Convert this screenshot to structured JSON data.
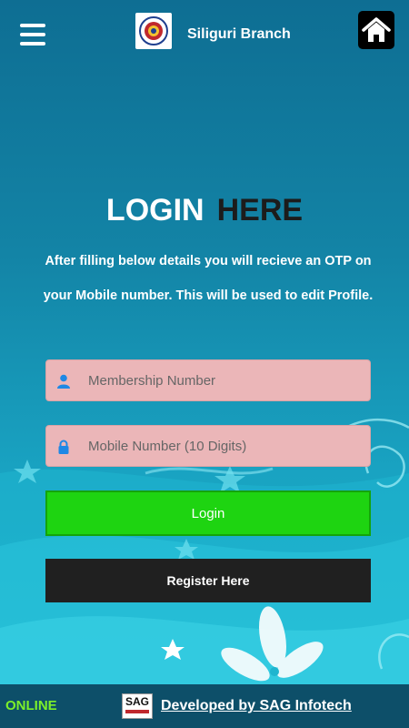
{
  "header": {
    "menu_icon": "hamburger-menu-icon",
    "logo_icon": "institute-emblem-logo",
    "branch_name": "Siliguri Branch",
    "home_icon": "home-icon"
  },
  "login": {
    "title_part1": "LOGIN",
    "title_part2": "HERE",
    "description": "After filling below details you will recieve an OTP on your Mobile number. This will be used to edit Profile.",
    "membership_placeholder": "Membership Number",
    "membership_value": "",
    "mobile_placeholder": "Mobile Number (10 Digits)",
    "mobile_value": "",
    "login_button": "Login",
    "register_button": "Register Here"
  },
  "footer": {
    "status": "ONLINE",
    "sag_logo_text": "SAG",
    "developer_link": "Developed by SAG Infotech"
  },
  "colors": {
    "background_top": "#0e6e93",
    "background_bottom": "#1fb5cf",
    "field_bg": "#ebb6b8",
    "login_button": "#1ed411",
    "register_button": "#202020",
    "online_status": "#7cf02a",
    "icon_blue": "#1e88e5"
  }
}
